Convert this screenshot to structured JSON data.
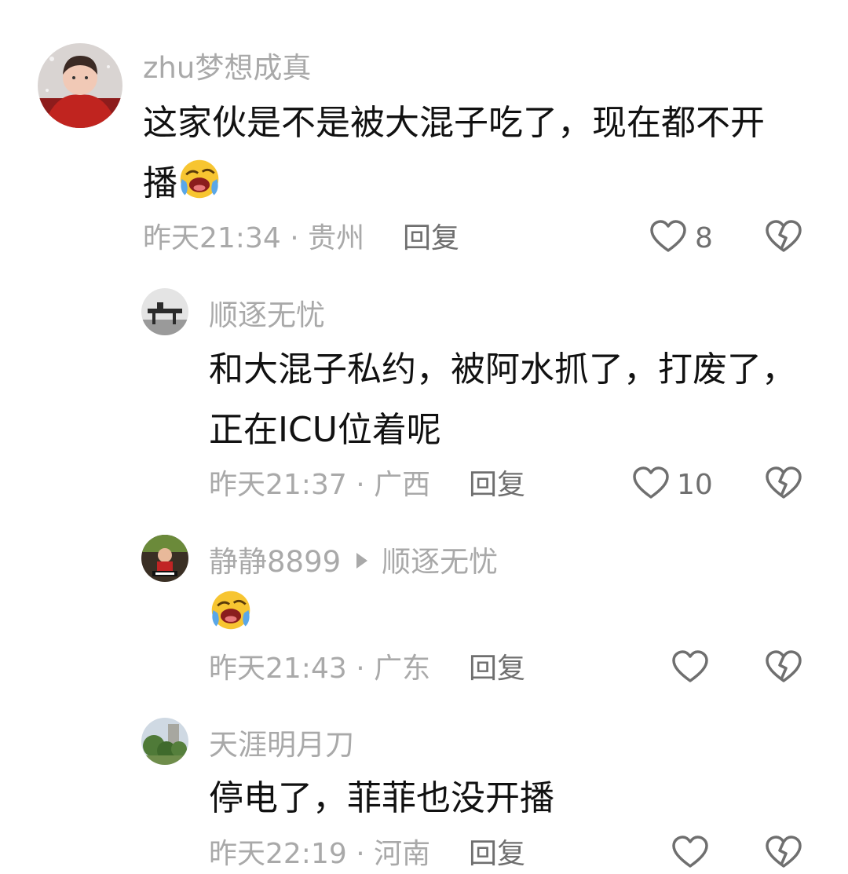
{
  "comments": [
    {
      "username": "zhu梦想成真",
      "text_lines": [
        "这家伙是不是被大混子吃了，现在都不开",
        "播"
      ],
      "emoji_name": "rolling-laughing-emoji",
      "time": "昨天21:34",
      "sep": "·",
      "location": "贵州",
      "reply_label": "回复",
      "likes": "8",
      "avatar_icon": "user-avatar-red-scarf"
    },
    {
      "username": "顺逐无忧",
      "text_lines": [
        "和大混子私约，被阿水抓了，打废了，",
        "正在ICU位着呢"
      ],
      "time": "昨天21:37",
      "sep": "·",
      "location": "广西",
      "reply_label": "回复",
      "likes": "10",
      "avatar_icon": "user-avatar-rifle"
    },
    {
      "username": "静静8899",
      "reply_to": "顺逐无忧",
      "emoji_name": "rolling-laughing-emoji",
      "time": "昨天21:43",
      "sep": "·",
      "location": "广东",
      "reply_label": "回复",
      "likes": "",
      "avatar_icon": "user-avatar-douyin"
    },
    {
      "username": "天涯明月刀",
      "text_lines": [
        "停电了，菲菲也没开播"
      ],
      "time": "昨天22:19",
      "sep": "·",
      "location": "河南",
      "reply_label": "回复",
      "likes": "",
      "avatar_icon": "user-avatar-trees"
    }
  ],
  "colors": {
    "text": "#111111",
    "meta": "#a9a9a9",
    "action": "#6f6f6f",
    "background": "#ffffff"
  },
  "icons": {
    "like": "heart-outline-icon",
    "dislike": "broken-heart-icon",
    "reply_arrow": "triangle-right-icon"
  }
}
